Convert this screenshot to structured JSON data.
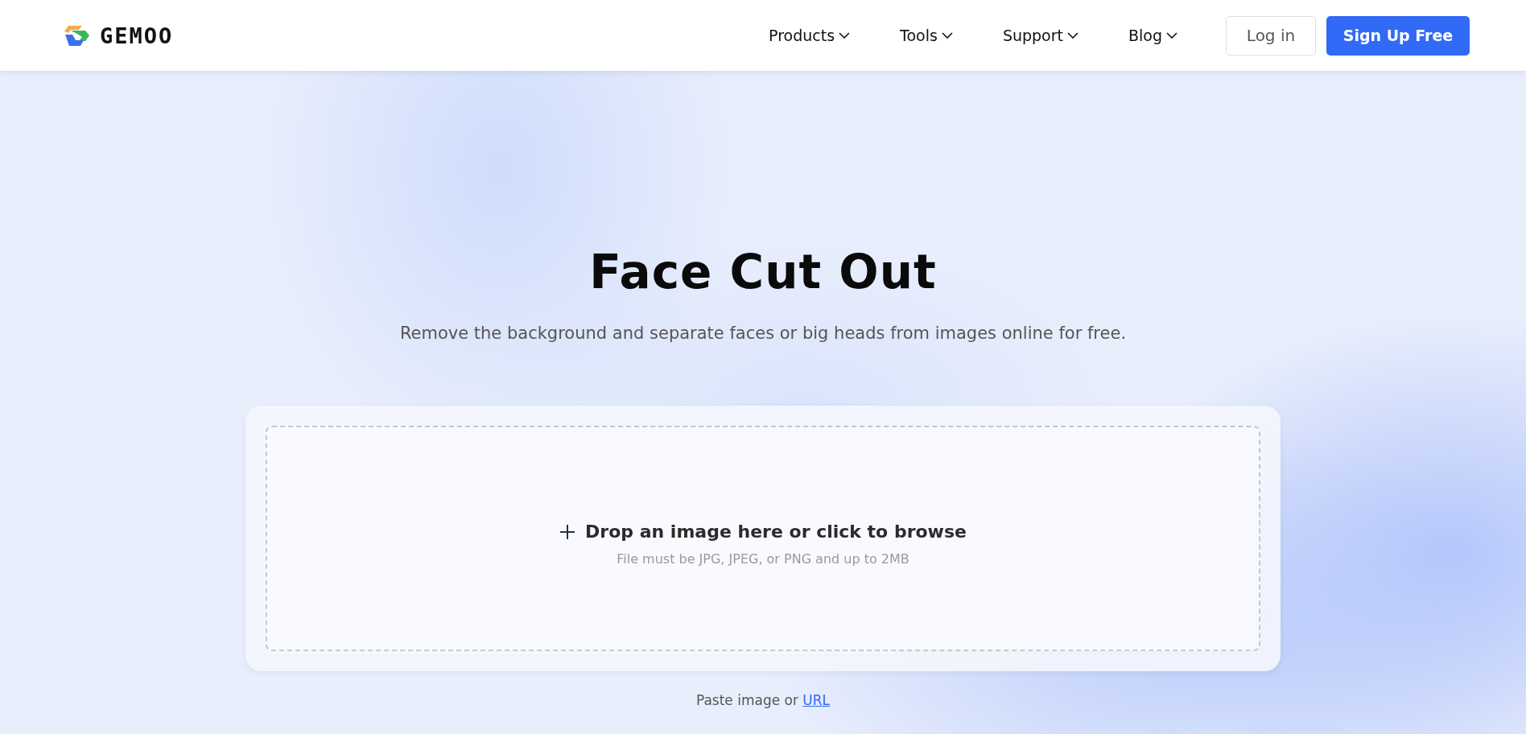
{
  "header": {
    "logo": "GEMOO",
    "nav": [
      {
        "label": "Products"
      },
      {
        "label": "Tools"
      },
      {
        "label": "Support"
      },
      {
        "label": "Blog"
      }
    ],
    "login": "Log in",
    "signup": "Sign Up Free"
  },
  "hero": {
    "title": "Face Cut Out",
    "subtitle": "Remove the background and separate faces or big heads from images online for free."
  },
  "upload": {
    "prompt": "Drop an image here or click to browse",
    "hint": "File must be JPG, JPEG, or PNG and up to 2MB"
  },
  "paste": {
    "text": "Paste image or",
    "link": "URL"
  }
}
